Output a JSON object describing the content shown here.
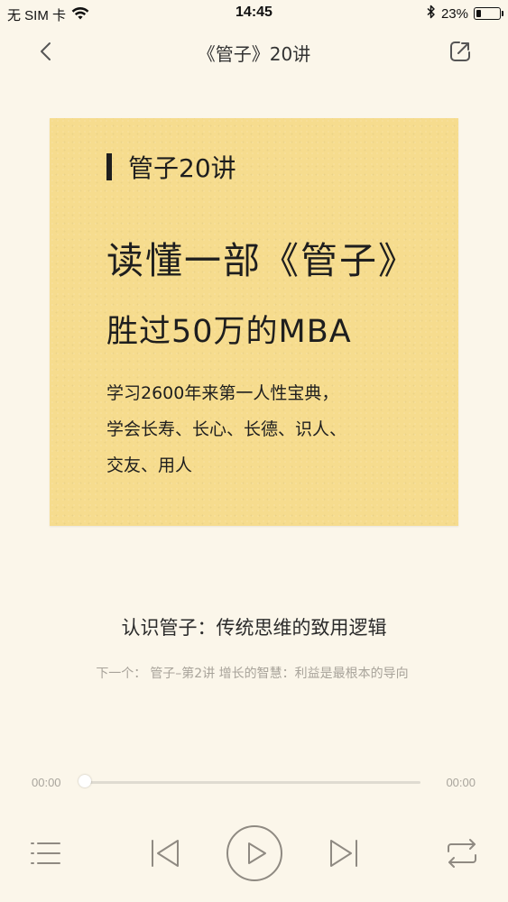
{
  "status_bar": {
    "carrier": "无 SIM 卡",
    "time": "14:45",
    "battery": "23%",
    "battery_level": 0.23
  },
  "nav": {
    "title": "《管子》20讲",
    "back_icon": "chevron-left-icon",
    "share_icon": "share-out-icon"
  },
  "cover": {
    "series": "管子20讲",
    "headline": "读懂一部《管子》",
    "subhead": "胜过50万的MBA",
    "lines": [
      "学习2600年来第一人性宝典，",
      "学会长寿、长心、长德、识人、",
      "交友、用人"
    ],
    "background_color": "#f6dc8e"
  },
  "track": {
    "title": "认识管子：传统思维的致用逻辑",
    "next_label": "下一个：",
    "next_title": "管子–第2讲 增长的智慧：利益是最根本的导向"
  },
  "player": {
    "current_time": "00:00",
    "total_time": "00:00",
    "progress": 0
  },
  "controls": {
    "playlist_icon": "playlist-icon",
    "prev_icon": "skip-previous-icon",
    "play_icon": "play-icon",
    "next_icon": "skip-next-icon",
    "repeat_icon": "repeat-icon"
  },
  "colors": {
    "background": "#fbf6ea",
    "icon": "#8f8a82"
  }
}
